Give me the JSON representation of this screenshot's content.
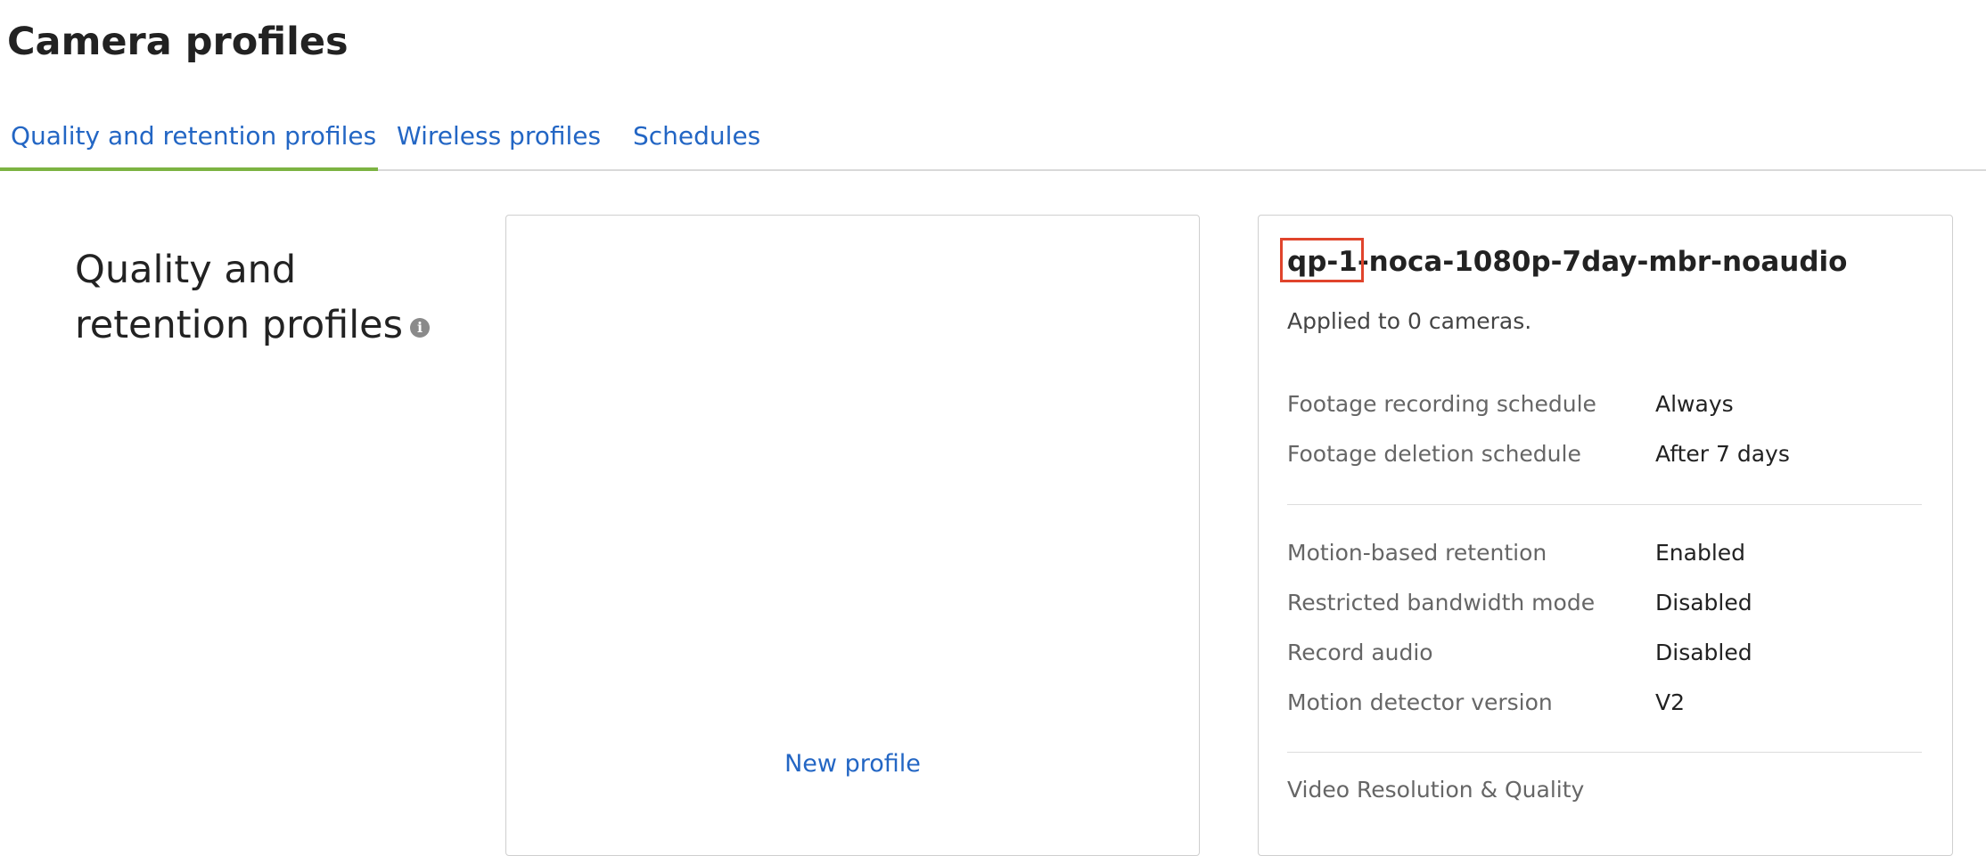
{
  "page": {
    "title": "Camera profiles"
  },
  "tabs": [
    {
      "label": "Quality and retention profiles",
      "active": true
    },
    {
      "label": "Wireless profiles",
      "active": false
    },
    {
      "label": "Schedules",
      "active": false
    }
  ],
  "section": {
    "heading_line1": "Quality and",
    "heading_line2": "retention profiles",
    "info_icon": "info-icon",
    "info_glyph": "i"
  },
  "list_panel": {
    "new_profile_label": "New profile"
  },
  "detail": {
    "profile_name": "qp-1-noca-1080p-7day-mbr-noaudio",
    "applied_text": "Applied to 0 cameras.",
    "schedule_rows": [
      {
        "label": "Footage recording schedule",
        "value": "Always"
      },
      {
        "label": "Footage deletion schedule",
        "value": "After 7 days"
      }
    ],
    "setting_rows": [
      {
        "label": "Motion-based retention",
        "value": "Enabled"
      },
      {
        "label": "Restricted bandwidth mode",
        "value": "Disabled"
      },
      {
        "label": "Record audio",
        "value": "Disabled"
      },
      {
        "label": "Motion detector version",
        "value": "V2"
      }
    ],
    "video_heading": "Video Resolution & Quality"
  },
  "colors": {
    "link": "#2366c4",
    "active_tab_underline": "#7cb342",
    "highlight_box": "#e0442c"
  }
}
